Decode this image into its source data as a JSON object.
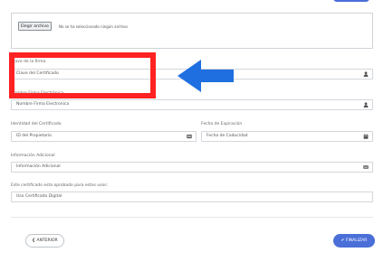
{
  "upload": {
    "choose_label": "Elegir archivo",
    "no_file_text": "No se ha seleccionado ningún archivo"
  },
  "form": {
    "clave_label": "Clave de la firma",
    "clave_placeholder": "Clave del Certificado",
    "nombre_label": "Nombre Firma Electrónica",
    "nombre_placeholder": "Nombre Firma Electronica",
    "identidad_label": "Identidad del Certificado",
    "identidad_placeholder": "ID del Propietario",
    "fecha_label": "Fecha de Expiración",
    "fecha_placeholder": "Fecha de Caducidad",
    "info_label": "Información Adicional",
    "info_placeholder": "Información Adicional",
    "uso_label": "Este certificado esta aprobado para estos usos:",
    "uso_placeholder": "Uso Certificado Digital"
  },
  "nav": {
    "prev_label": "ANTERIOR",
    "finish_label": "FINALIZAR"
  },
  "colors": {
    "accent": "#4a6fd8",
    "highlight": "#ff2222",
    "arrow": "#1f6fe0"
  }
}
